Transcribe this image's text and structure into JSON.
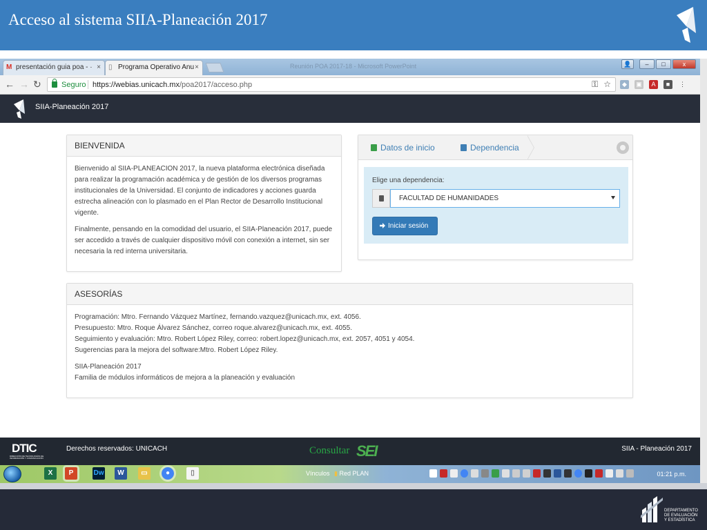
{
  "slide": {
    "title": "Acceso al sistema SIIA-Planeación 2017"
  },
  "browser": {
    "tabs": [
      {
        "label": "presentación guia poa - ·",
        "icon": "gmail-icon"
      },
      {
        "label": "Programa Operativo Anu",
        "icon": "page-icon"
      }
    ],
    "window_title": "Reunión POA 2017-18 - Microsoft PowerPoint",
    "secure_label": "Seguro",
    "url_host": "https://webias.unicach.mx",
    "url_path": "/poa2017/acceso.php"
  },
  "app": {
    "brand": "SIIA-Planeación 2017"
  },
  "welcome": {
    "heading": "BIENVENIDA",
    "paragraph1": "Bienvenido al SIIA-PLANEACION 2017, la nueva plataforma electrónica diseñada para realizar la programación académica y de gestión de los diversos programas institucionales de la Universidad. El conjunto de indicadores y acciones guarda estrecha alineación con lo plasmado en el Plan Rector de Desarrollo Institucional vigente.",
    "paragraph2": "Finalmente, pensando en la comodidad del usuario, el SIIA-Planeación 2017, puede ser accedido a través de cualquier dispositivo móvil con conexión a internet, sin ser necesaria la red interna universitaria."
  },
  "login": {
    "tab_start": "Datos de inicio",
    "tab_dependency": "Dependencia",
    "select_label": "Elige una dependencia:",
    "select_value": "FACULTAD DE HUMANIDADES",
    "submit_label": "Iniciar sesión"
  },
  "advisory": {
    "heading": "ASESORÍAS",
    "lines": [
      "Programación: Mtro. Fernando Vázquez Martínez, fernando.vazquez@unicach.mx, ext. 4056.",
      "Presupuesto: Mtro. Roque Álvarez Sánchez, correo roque.alvarez@unicach.mx, ext. 4055.",
      "Seguimiento y evaluación: Mtro. Robert López Riley, correo: robert.lopez@unicach.mx, ext. 2057, 4051 y 4054.",
      "Sugerencias para la mejora del software:Mtro. Robert López Riley."
    ],
    "product_name": "SIIA-Planeación 2017",
    "product_desc": "Familia de módulos informáticos de mejora a la planeación y evaluación"
  },
  "footer": {
    "dtic": "DTIC",
    "dtic_sub": "DIRECCIÓN DE TECNOLOGÍAS DE INFORMACIÓN Y COMUNICACIÓN",
    "rights": "Derechos reservados: UNICACH",
    "consult": "Consultar",
    "sei": "SEI",
    "brand": "SIIA - Planeación 2017"
  },
  "taskbar": {
    "links_label": "Vínculos",
    "red_plan": "Red PLAN",
    "clock": "01:21 p.m."
  },
  "dept": {
    "line1": "DEPARTAMENTO",
    "line2": "DE EVALUACIÓN",
    "line3": "Y ESTADÍSTICA"
  },
  "colors": {
    "slide_blue": "#3a7ebf",
    "nav_dark": "#282e3a",
    "link_blue": "#3f7fb4",
    "button_blue": "#337ab7",
    "consult_green": "#28a745"
  }
}
